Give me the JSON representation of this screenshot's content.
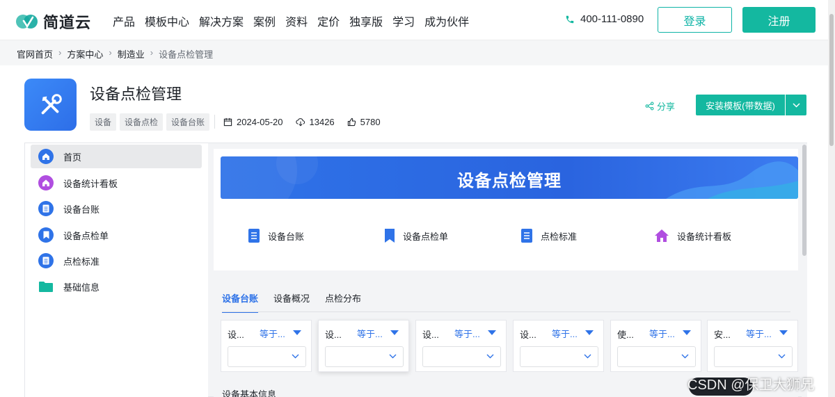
{
  "brand": {
    "name": "简道云"
  },
  "nav": {
    "items": [
      "产品",
      "模板中心",
      "解决方案",
      "案例",
      "资料",
      "定价",
      "独享版",
      "学习",
      "成为伙伴"
    ],
    "phone": "400-111-0890",
    "login": "登录",
    "register": "注册"
  },
  "breadcrumb": [
    "官网首页",
    "方案中心",
    "制造业",
    "设备点检管理"
  ],
  "product": {
    "title": "设备点检管理",
    "tags": [
      "设备",
      "设备点检",
      "设备台账"
    ],
    "date": "2024-05-20",
    "downloads": "13426",
    "likes": "5780",
    "share": "分享",
    "install": "安装模板(带数据)"
  },
  "sidebar": {
    "items": [
      {
        "label": "首页",
        "icon": "home-icon",
        "color": "#2f73e8"
      },
      {
        "label": "设备统计看板",
        "icon": "home-icon",
        "color": "#b04ee0"
      },
      {
        "label": "设备台账",
        "icon": "document-icon",
        "color": "#2f73e8"
      },
      {
        "label": "设备点检单",
        "icon": "bookmark-icon",
        "color": "#2f73e8"
      },
      {
        "label": "点检标准",
        "icon": "document-icon",
        "color": "#2f73e8"
      },
      {
        "label": "基础信息",
        "icon": "folder-icon",
        "color": "#14b8a0"
      }
    ]
  },
  "preview": {
    "banner": "设备点检管理",
    "quick": [
      {
        "label": "设备台账",
        "icon": "document-icon"
      },
      {
        "label": "设备点检单",
        "icon": "bookmark-icon"
      },
      {
        "label": "点检标准",
        "icon": "document-icon"
      },
      {
        "label": "设备统计看板",
        "icon": "home-icon"
      }
    ],
    "tabs": [
      "设备台账",
      "设备概况",
      "点检分布"
    ],
    "filters": [
      {
        "label": "设...",
        "op": "等于..."
      },
      {
        "label": "设...",
        "op": "等于..."
      },
      {
        "label": "设...",
        "op": "等于..."
      },
      {
        "label": "设...",
        "op": "等于..."
      },
      {
        "label": "使...",
        "op": "等于..."
      },
      {
        "label": "安...",
        "op": "等于..."
      }
    ],
    "section": "设备基本信息"
  },
  "watermark": "CSDN @保卫大狮兄",
  "colors": {
    "accent": "#14b8a0",
    "blue": "#2f73e8"
  }
}
